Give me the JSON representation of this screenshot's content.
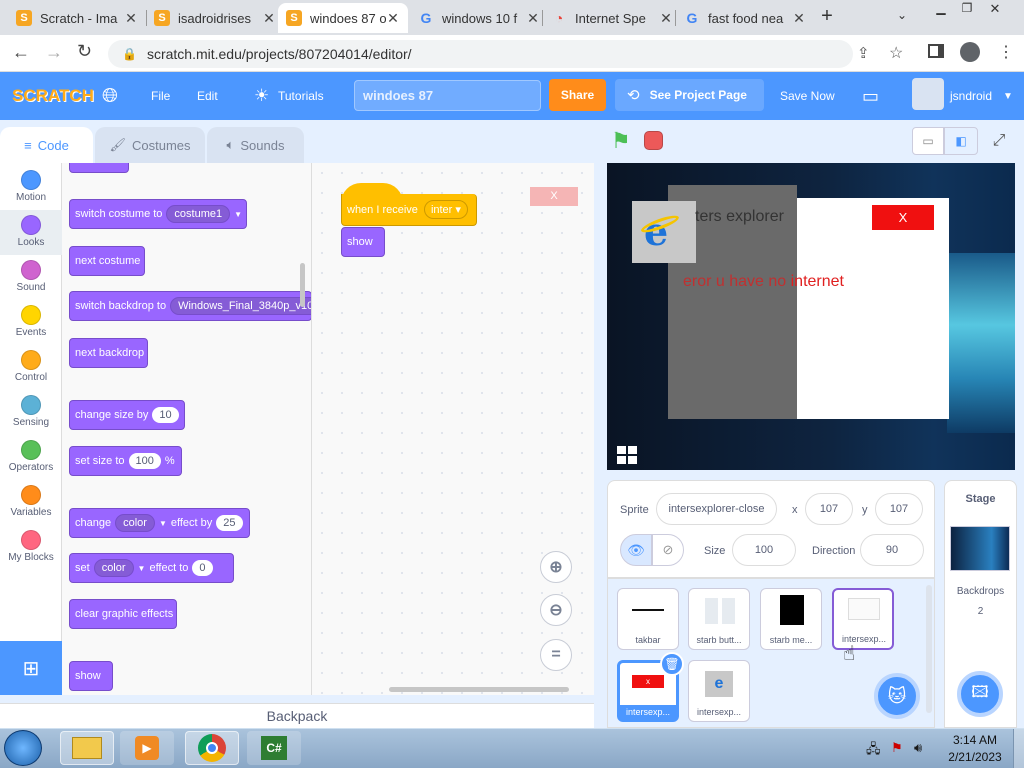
{
  "browser": {
    "tabs": [
      {
        "title": "Scratch - Ima",
        "favicon": "scratch-icon"
      },
      {
        "title": "isadroidrises",
        "favicon": "scratch-icon"
      },
      {
        "title": "windoes 87 o",
        "favicon": "scratch-icon"
      },
      {
        "title": "windows 10 f",
        "favicon": "google-icon"
      },
      {
        "title": "Internet Spe",
        "favicon": "speedometer-icon"
      },
      {
        "title": "fast food nea",
        "favicon": "google-icon"
      }
    ],
    "url": "scratch.mit.edu/projects/807204014/editor/"
  },
  "menu": {
    "logo": "SCRATCH",
    "file": "File",
    "edit": "Edit",
    "tutorials": "Tutorials",
    "project_title": "windoes 87",
    "share": "Share",
    "see_project": "See Project Page",
    "save_now": "Save Now",
    "username": "jsndroid"
  },
  "editor_tabs": {
    "code": "Code",
    "costumes": "Costumes",
    "sounds": "Sounds"
  },
  "categories": [
    {
      "label": "Motion",
      "color": "#4c97ff"
    },
    {
      "label": "Looks",
      "color": "#9966ff"
    },
    {
      "label": "Sound",
      "color": "#cf63cf"
    },
    {
      "label": "Events",
      "color": "#ffd500"
    },
    {
      "label": "Control",
      "color": "#ffab19"
    },
    {
      "label": "Sensing",
      "color": "#5cb1d6"
    },
    {
      "label": "Operators",
      "color": "#59c059"
    },
    {
      "label": "Variables",
      "color": "#ff8c1a"
    },
    {
      "label": "My Blocks",
      "color": "#ff6680"
    }
  ],
  "blocks": {
    "switch_costume": {
      "text": "switch costume to",
      "value": "costume1"
    },
    "next_costume": "next costume",
    "switch_backdrop": {
      "text": "switch backdrop to",
      "value": "Windows_Final_3840p_v10"
    },
    "next_backdrop": "next backdrop",
    "change_size": {
      "text": "change size by",
      "value": "10"
    },
    "set_size": {
      "text": "set size to",
      "value": "100",
      "unit": "%"
    },
    "change_effect": {
      "text1": "change",
      "effect": "color",
      "text2": "effect by",
      "value": "25"
    },
    "set_effect": {
      "text1": "set",
      "effect": "color",
      "text2": "effect to",
      "value": "0"
    },
    "clear_effects": "clear graphic effects",
    "show": "show"
  },
  "script": {
    "hat": "when I receive",
    "message": "inter",
    "action": "show",
    "x_label": "X"
  },
  "backpack": "Backpack",
  "stage": {
    "window_title": "ters explorer",
    "close_label": "X",
    "error_text_a": "eror u have no ",
    "error_text_b": "internet"
  },
  "sprite_info": {
    "sprite_label": "Sprite",
    "name": "intersexplorer-close",
    "x_label": "x",
    "x": "107",
    "y_label": "y",
    "y": "107",
    "size_label": "Size",
    "size": "100",
    "direction_label": "Direction",
    "direction": "90"
  },
  "sprites": [
    {
      "name": "takbar"
    },
    {
      "name": "starb butt..."
    },
    {
      "name": "starb me..."
    },
    {
      "name": "intersexp..."
    },
    {
      "name": "intersexp..."
    },
    {
      "name": "intersexp..."
    }
  ],
  "stage_pane": {
    "title": "Stage",
    "backdrops_label": "Backdrops",
    "backdrops_count": "2"
  },
  "taskbar": {
    "time": "3:14 AM",
    "date": "2/21/2023"
  }
}
